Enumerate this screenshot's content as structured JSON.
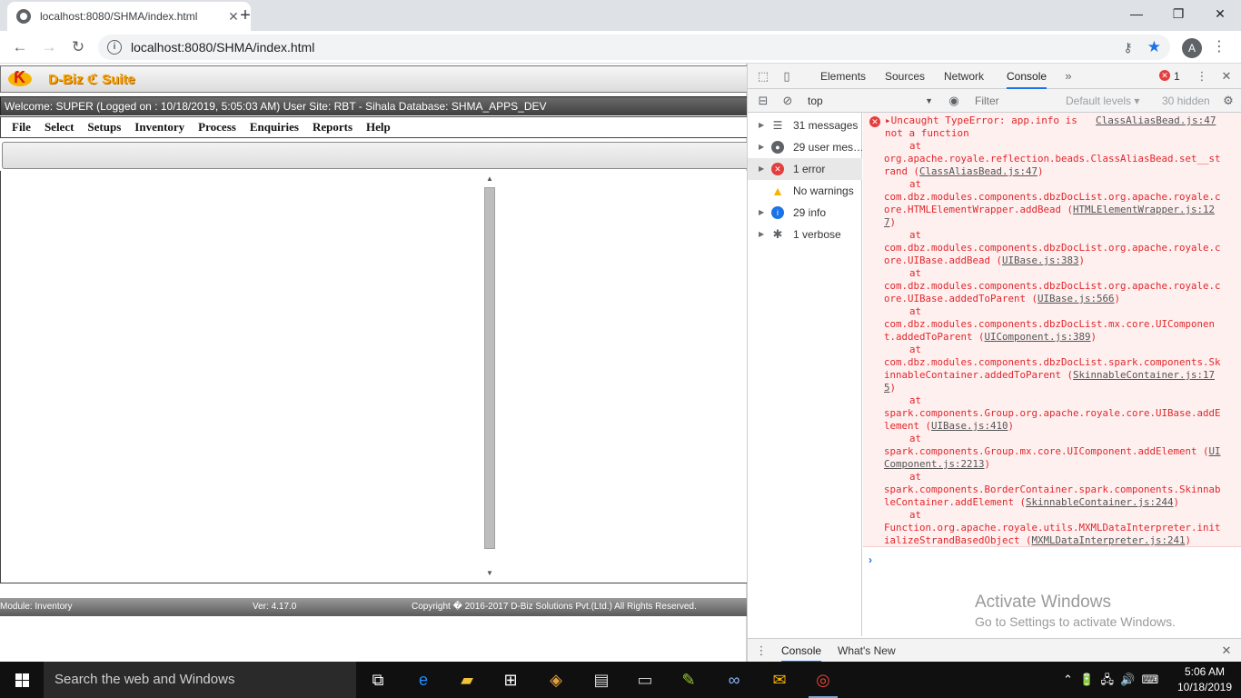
{
  "browser": {
    "tab_title": "localhost:8080/SHMA/index.html",
    "url": "localhost:8080/SHMA/index.html",
    "profile_initial": "A",
    "window_controls": [
      "—",
      "❐",
      "✕"
    ]
  },
  "app": {
    "brand": "D-Biz ℭ Suite",
    "welcome": "Welcome: SUPER (Logged on : 10/18/2019, 5:05:03 AM) User Site: RBT - Sihala Database: SHMA_APPS_DEV",
    "menu": [
      "File",
      "Select",
      "Setups",
      "Inventory",
      "Process",
      "Enquiries",
      "Reports",
      "Help"
    ],
    "status": {
      "module": "Module: Inventory",
      "version": "Ver: 4.17.0",
      "copyright": "Copyright � 2016-2017 D-Biz Solutions Pvt.(Ltd.) All Rights Reserved."
    }
  },
  "devtools": {
    "tabs": [
      "Elements",
      "Sources",
      "Network",
      "Console"
    ],
    "active_tab": "Console",
    "error_count": "1",
    "context": "top",
    "filter_placeholder": "Filter",
    "levels": "Default levels ▾",
    "hidden": "30 hidden",
    "sidebar": [
      {
        "label": "31 messages",
        "icon": "list-icon"
      },
      {
        "label": "29 user mes…",
        "icon": "user-icon"
      },
      {
        "label": "1 error",
        "icon": "error-icon"
      },
      {
        "label": "No warnings",
        "icon": "warning-icon"
      },
      {
        "label": "29 info",
        "icon": "info-icon"
      },
      {
        "label": "1 verbose",
        "icon": "verbose-icon"
      }
    ],
    "error": {
      "message": "Uncaught TypeError: app.info is not a function",
      "source": "ClassAliasBead.js:47",
      "stack": [
        {
          "text": "org.apache.royale.reflection.beads.ClassAliasBead.set__strand (",
          "link": "ClassAliasBead.js:47"
        },
        {
          "text": "com.dbz.modules.components.dbzDocList.org.apache.royale.core.HTMLElementWrapper.addBead (",
          "link": "HTMLElementWrapper.js:127"
        },
        {
          "text": "com.dbz.modules.components.dbzDocList.org.apache.royale.core.UIBase.addBead (",
          "link": "UIBase.js:383"
        },
        {
          "text": "com.dbz.modules.components.dbzDocList.org.apache.royale.core.UIBase.addedToParent (",
          "link": "UIBase.js:566"
        },
        {
          "text": "com.dbz.modules.components.dbzDocList.mx.core.UIComponent.addedToParent (",
          "link": "UIComponent.js:389"
        },
        {
          "text": "com.dbz.modules.components.dbzDocList.spark.components.SkinnableContainer.addedToParent (",
          "link": "SkinnableContainer.js:175"
        },
        {
          "text": "spark.components.Group.org.apache.royale.core.UIBase.addElement (",
          "link": "UIBase.js:410"
        },
        {
          "text": "spark.components.Group.mx.core.UIComponent.addElement (",
          "link": "UIComponent.js:2213"
        },
        {
          "text": "spark.components.BorderContainer.spark.components.SkinnableContainer.addElement (",
          "link": "SkinnableContainer.js:244"
        },
        {
          "text": "Function.org.apache.royale.utils.MXMLDataInterpreter.initializeStrandBasedObject (",
          "link": "MXMLDataInterpreter.js:241"
        }
      ]
    },
    "drawer_tabs": [
      "Console",
      "What's New"
    ]
  },
  "watermark": {
    "line1": "Activate Windows",
    "line2": "Go to Settings to activate Windows."
  },
  "taskbar": {
    "search": "Search the web and Windows",
    "time": "5:06 AM",
    "date": "10/18/2019"
  }
}
